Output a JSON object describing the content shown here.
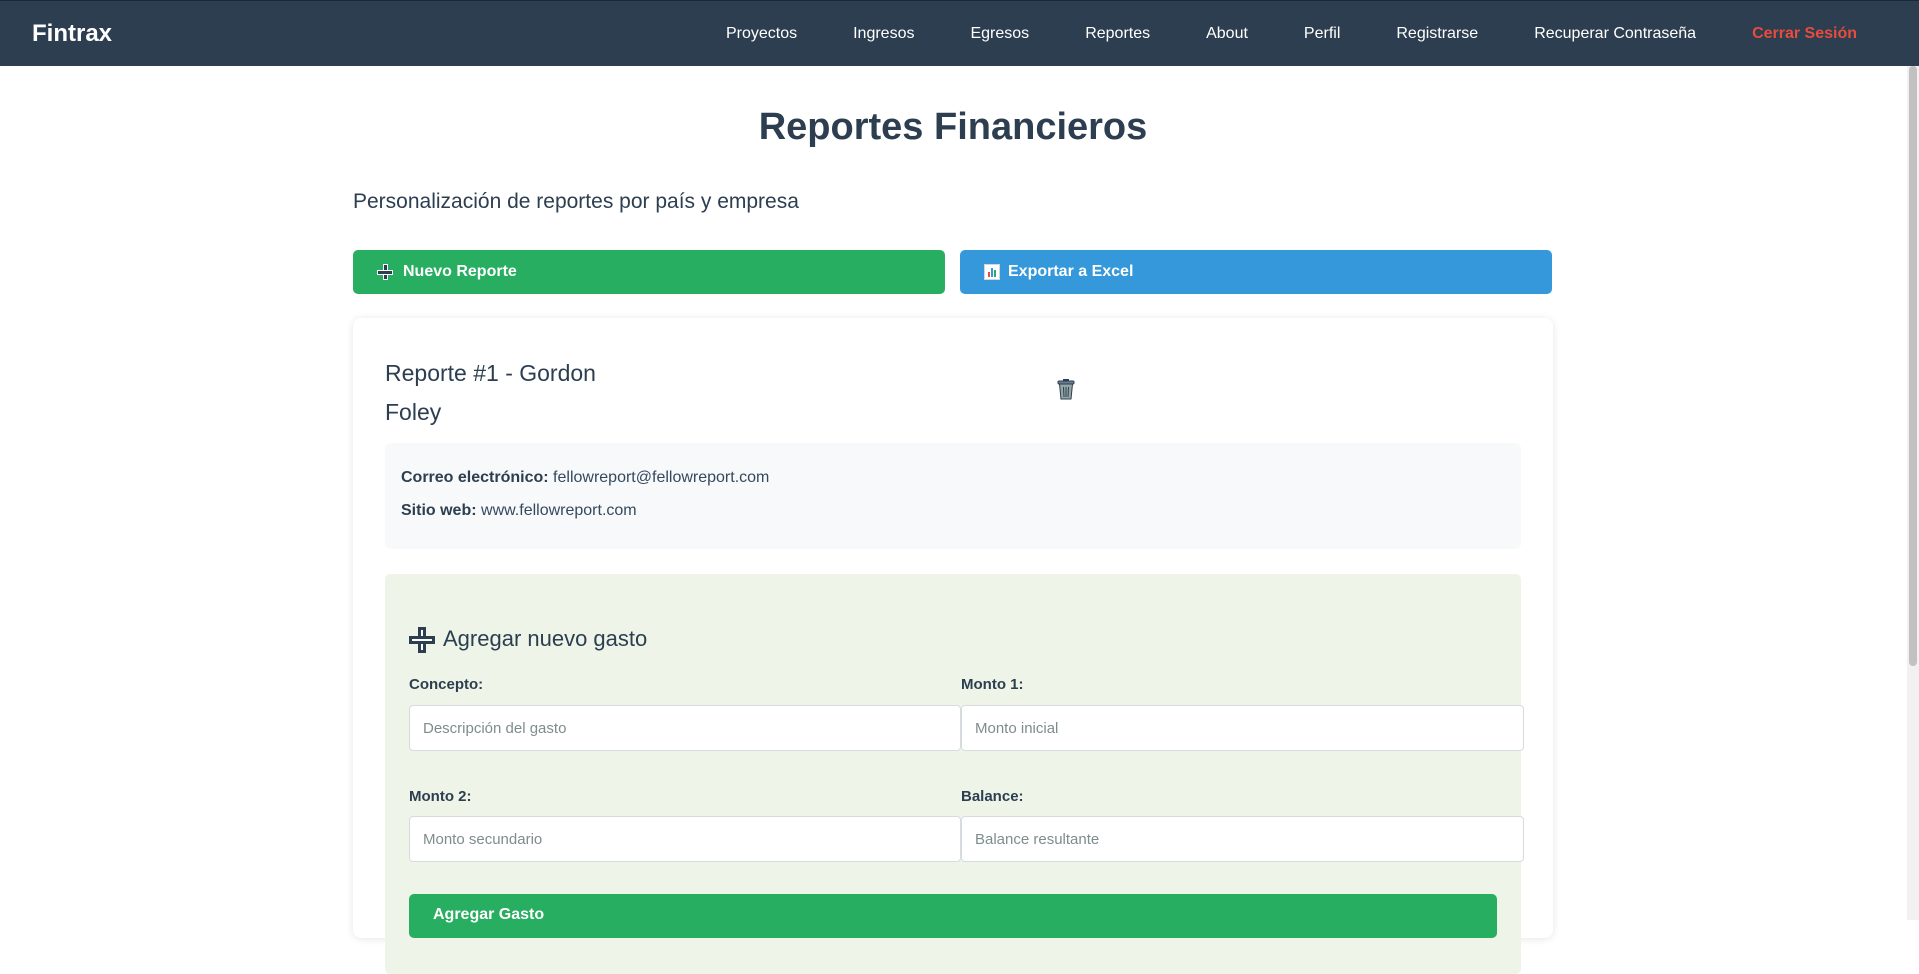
{
  "app": {
    "brand": "Fintrax"
  },
  "nav": {
    "items": [
      {
        "label": "Proyectos"
      },
      {
        "label": "Ingresos"
      },
      {
        "label": "Egresos"
      },
      {
        "label": "Reportes"
      },
      {
        "label": "About"
      },
      {
        "label": "Perfil"
      },
      {
        "label": "Registrarse"
      },
      {
        "label": "Recuperar Contraseña"
      }
    ],
    "logout_label": "Cerrar Sesión"
  },
  "page": {
    "title": "Reportes Financieros",
    "subtitle": "Personalización de reportes por país y empresa"
  },
  "actions": {
    "new_report_label": "Nuevo Reporte",
    "export_label": "Exportar a Excel"
  },
  "report": {
    "title": "Reporte #1 - Gordon Foley",
    "email_label": "Correo electrónico:",
    "email_value": "fellowreport@fellowreport.com",
    "website_label": "Sitio web:",
    "website_value": "www.fellowreport.com"
  },
  "expense_form": {
    "title": "Agregar nuevo gasto",
    "concept_label": "Concepto:",
    "concept_placeholder": "Descripción del gasto",
    "amount1_label": "Monto 1:",
    "amount1_placeholder": "Monto inicial",
    "amount2_label": "Monto 2:",
    "amount2_placeholder": "Monto secundario",
    "balance_label": "Balance:",
    "balance_placeholder": "Balance resultante",
    "submit_label": "Agregar Gasto"
  },
  "colors": {
    "navbar": "#2c3e50",
    "logout": "#e74c3c",
    "primary_green": "#27ae60",
    "primary_blue": "#3498db",
    "form_background": "#eef5e8"
  },
  "icons": {
    "new_report": "plus-icon",
    "export": "bar-chart-icon",
    "delete": "trash-icon",
    "expense_title": "plus-icon"
  }
}
